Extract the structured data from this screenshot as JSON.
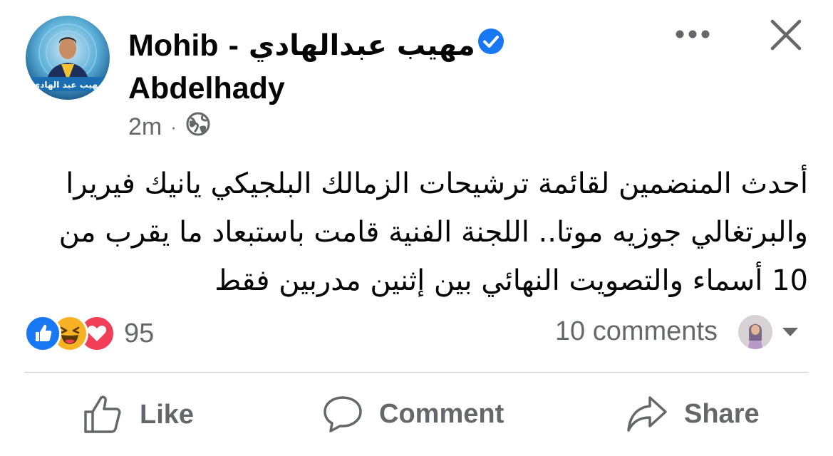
{
  "post": {
    "author_name_en_1": "Mohib",
    "author_separator": "-",
    "author_name_ar": "مهيب عبدالهادي",
    "author_name_en_2": "Abdelhady",
    "avatar_banner_text": "مهيب عبد الهادي",
    "time": "2m",
    "meta_separator": "·",
    "body": "أحدث المنضمين لقائمة ترشيحات الزمالك البلجيكي يانيك فيريرا والبرتغالي جوزيه موتا.. اللجنة الفنية قامت باستبعاد ما يقرب من 10 أسماء والتصويت النهائي بين إثنين مدربين فقط"
  },
  "stats": {
    "reaction_count": "95",
    "comments_label": "10 comments"
  },
  "actions": {
    "like_label": "Like",
    "comment_label": "Comment",
    "share_label": "Share"
  },
  "colors": {
    "brand_blue": "#1877f2",
    "secondary_text": "#65676b",
    "love_red": "#f33e58",
    "haha_yellow": "#f7b125"
  },
  "icons": [
    "verified-badge-icon",
    "globe-icon",
    "more-options-icon",
    "close-icon",
    "like-reaction-icon",
    "haha-reaction-icon",
    "love-reaction-icon",
    "caret-down-icon",
    "like-icon",
    "comment-icon",
    "share-icon"
  ]
}
